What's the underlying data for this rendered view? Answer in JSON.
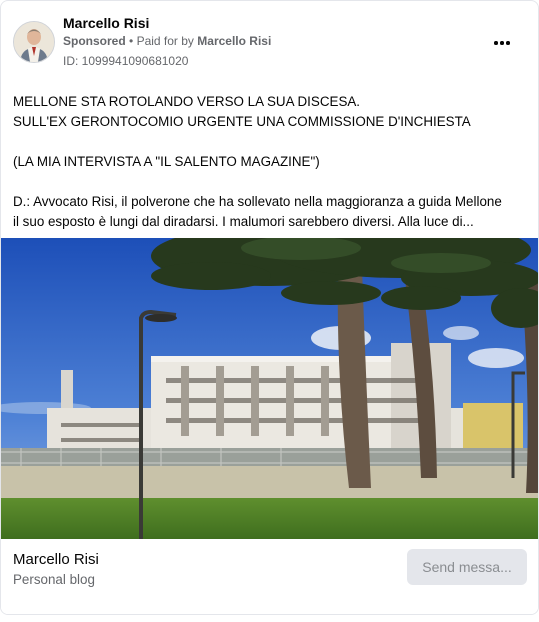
{
  "post": {
    "page_name": "Marcello Risi",
    "sponsored_label": "Sponsored",
    "separator": "•",
    "paid_for_prefix": "Paid for by",
    "paid_for_name": "Marcello Risi",
    "ad_id": "ID: 1099941090681020",
    "avatar_icon": "profile-photo",
    "more_icon": "more-horizontal-icon",
    "text_lines": [
      "MELLONE STA ROTOLANDO VERSO LA SUA DISCESA.",
      "SULL'EX GERONTOCOMIO URGENTE UNA COMMISSIONE D'INCHIESTA",
      "",
      "(LA MIA INTERVISTA A \"IL SALENTO MAGAZINE\")",
      "",
      "D.: Avvocato Risi, il polverone che ha sollevato nella maggioranza a guida Mellone",
      "il suo esposto è lungi dal diradarsi. I malumori sarebbero diversi. Alla luce di..."
    ]
  },
  "footer": {
    "name": "Marcello Risi",
    "subtitle": "Personal blog",
    "button_label": "Send messa..."
  },
  "colors": {
    "secondary_text": "#65676b",
    "button_bg": "#e4e6eb",
    "button_text": "#8a8d91",
    "border": "#e4e6eb"
  }
}
